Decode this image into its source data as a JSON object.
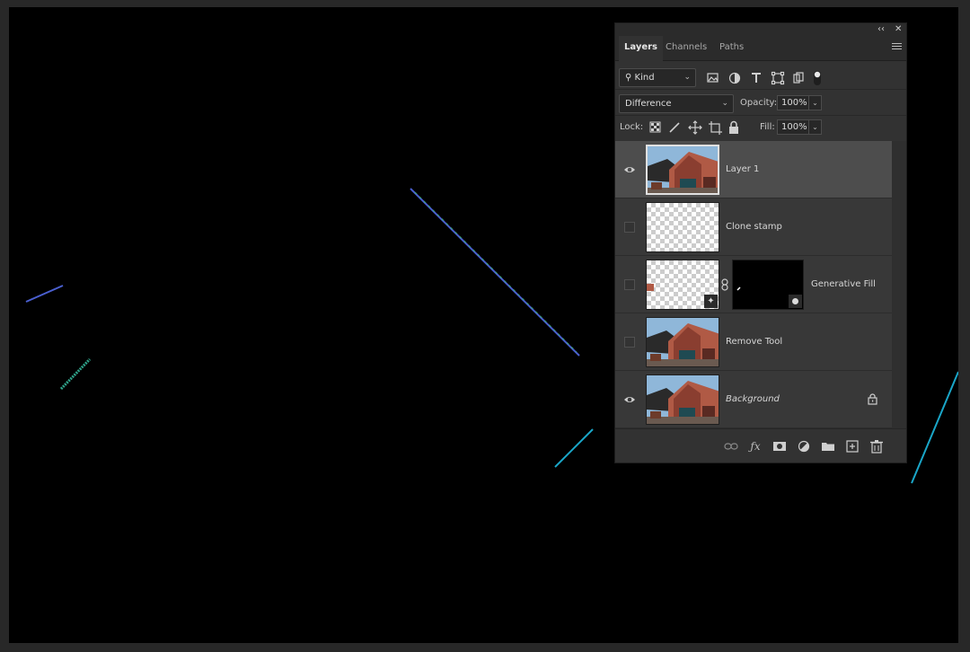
{
  "panel": {
    "collapse_glyph": "‹‹",
    "close_glyph": "✕",
    "tabs": [
      {
        "label": "Layers",
        "active": true
      },
      {
        "label": "Channels",
        "active": false
      },
      {
        "label": "Paths",
        "active": false
      }
    ]
  },
  "filter": {
    "kind_label": "Kind",
    "icons": [
      "image-filter-icon",
      "adjustment-filter-icon",
      "type-filter-icon",
      "shape-filter-icon",
      "smart-object-filter-icon",
      "filter-toggle-icon"
    ]
  },
  "blend": {
    "mode": "Difference",
    "opacity_label": "Opacity:",
    "opacity_value": "100%"
  },
  "lock": {
    "label": "Lock:",
    "fill_label": "Fill:",
    "fill_value": "100%"
  },
  "layers": [
    {
      "name": "Layer 1",
      "visible": true,
      "selected": true,
      "thumb": "photo",
      "italic": false
    },
    {
      "name": "Clone stamp",
      "visible": false,
      "selected": false,
      "thumb": "transparent",
      "italic": false
    },
    {
      "name": "Generative Fill",
      "visible": false,
      "selected": false,
      "thumb": "transparent-fill",
      "italic": false,
      "has_mask": true
    },
    {
      "name": "Remove Tool",
      "visible": false,
      "selected": false,
      "thumb": "photo",
      "italic": false
    },
    {
      "name": "Background",
      "visible": true,
      "selected": false,
      "thumb": "photo",
      "italic": true,
      "locked": true
    }
  ],
  "colors": {
    "canvas": "#000000",
    "panel": "#323232",
    "layer_selected": "#4d4d4d",
    "stroke_cyan": "#1aa6c8",
    "stroke_blue": "#4a5fd0"
  }
}
